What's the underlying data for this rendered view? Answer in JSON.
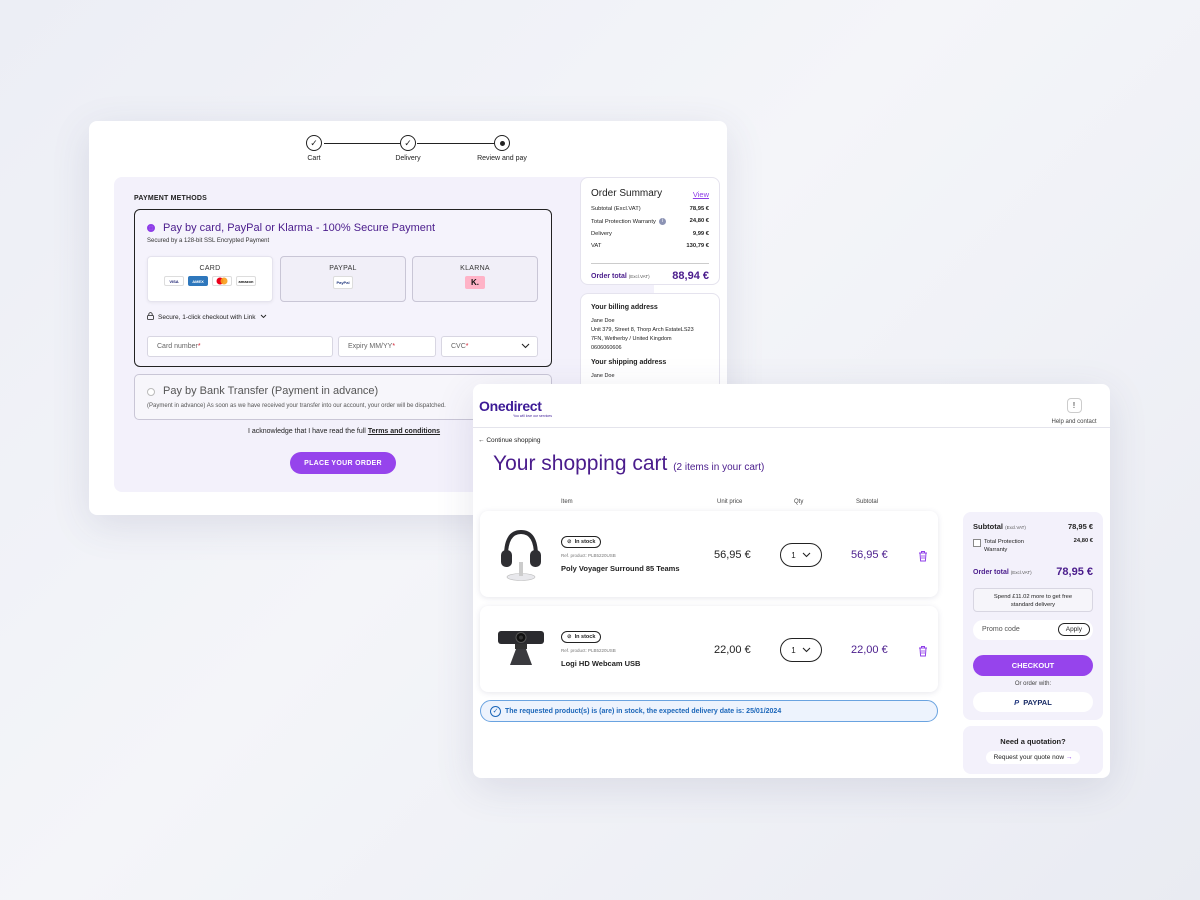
{
  "checkout": {
    "steps": [
      {
        "label": "Cart",
        "state": "done"
      },
      {
        "label": "Delivery",
        "state": "done"
      },
      {
        "label": "Review and pay",
        "state": "current"
      }
    ],
    "section_title": "PAYMENT METHODS",
    "card_method": {
      "title": "Pay by card, PayPal or Klarma - 100% Secure Payment",
      "subtitle": "Secured by a 128-bit SSL Encrypted Payment",
      "options": [
        {
          "label": "CARD",
          "selected": true
        },
        {
          "label": "PAYPAL",
          "selected": false
        },
        {
          "label": "KLARNA",
          "selected": false
        }
      ],
      "card_logos": [
        "VISA",
        "AMEX",
        "mastercard",
        "amazon"
      ],
      "paypal_logo": "PayPal",
      "klarna_logo": "K.",
      "link_checkout": "Secure, 1-click checkout with Link",
      "fields": {
        "card_number": "Card number",
        "expiry": "Expiry MM/YY",
        "cvc": "CVC",
        "required_mark": "*"
      }
    },
    "bank_method": {
      "title": "Pay by Bank Transfer (Payment in advance)",
      "subtitle": "(Payment in advance) As soon as we have received your transfer into our account, your order will be dispatched."
    },
    "acknowledge_text": "I acknowledge that I have read the full",
    "terms_link": "Terms and conditions",
    "place_order": "PLACE YOUR ORDER",
    "summary": {
      "title": "Order Summary",
      "view_link": "View",
      "rows": [
        {
          "label": "Subtotal (Excl.VAT)",
          "value": "78,95 €"
        },
        {
          "label": "Total Protection Warranty",
          "value": "24,80 €"
        },
        {
          "label": "Delivery",
          "value": "9,99 €"
        },
        {
          "label": "VAT",
          "value": "130,79 €"
        }
      ],
      "total_label": "Order total",
      "total_note": "(Excl.VAT)",
      "total_value": "88,94 €"
    },
    "billing": {
      "title": "Your billing address",
      "lines": [
        "Jane Doe",
        "Unit 379, Street 8, Thorp Arch EstateLS23",
        "7FN, Wetherby / United Kingdom",
        "0606060606"
      ],
      "shipping_title": "Your shipping address",
      "shipping_name": "Jane Doe"
    }
  },
  "cart": {
    "brand": "Onedirect",
    "brand_tagline": "You will love our services",
    "help_label": "Help and contact",
    "continue_shopping": "Continue shopping",
    "title": "Your shopping cart",
    "count_text": "(2 items in your cart)",
    "columns": {
      "item": "Item",
      "unit_price": "Unit price",
      "qty": "Qty",
      "subtotal": "Subtotal"
    },
    "items": [
      {
        "stock": "In stock",
        "ref": "Ref. product: PLB5220USB",
        "name": "Poly Voyager Surround 85 Teams",
        "unit_price": "56,95 €",
        "qty": "1",
        "subtotal": "56,95 €"
      },
      {
        "stock": "In stock",
        "ref": "Ref. product: PLB5220USB",
        "name": "Logi HD Webcam USB",
        "unit_price": "22,00 €",
        "qty": "1",
        "subtotal": "22,00 €"
      }
    ],
    "notice": "The requested product(s) is (are) in stock, the expected delivery date is: 25/01/2024",
    "summary": {
      "subtotal_label": "Subtotal",
      "subtotal_note": "(Excl.VAT)",
      "subtotal_value": "78,95 €",
      "warranty_label": "Total Protection Warranty",
      "warranty_value": "24,80 €",
      "total_label": "Order total",
      "total_note": "(Excl.VAT)",
      "total_value": "78,95 €",
      "spend_line1": "Spend £11.02 more to get free",
      "spend_line2": "standard delivery",
      "promo_placeholder": "Promo code",
      "apply": "Apply",
      "checkout": "CHECKOUT",
      "or_order_with": "Or order with:",
      "paypal": "PAYPAL"
    },
    "quotation": {
      "title": "Need a quotation?",
      "link": "Request your quote now"
    }
  },
  "colors": {
    "accent": "#9644ec",
    "primary_text": "#4a1c8c",
    "info": "#1b66b9"
  }
}
